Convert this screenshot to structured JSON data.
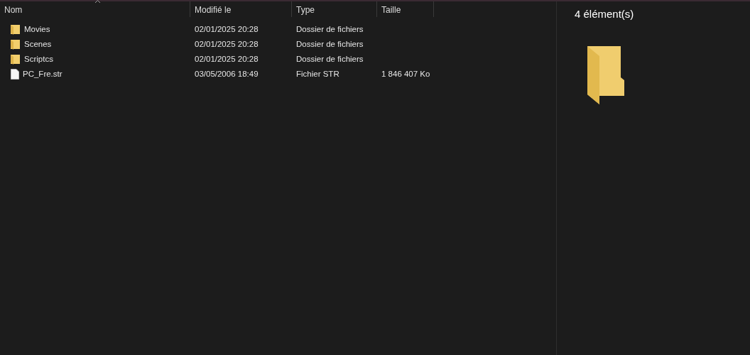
{
  "columns": [
    "Nom",
    "Modifié le",
    "Type",
    "Taille"
  ],
  "files": [
    {
      "kind": "folder",
      "name": "Movies",
      "modified": "02/01/2025 20:28",
      "type": "Dossier de fichiers"
    },
    {
      "kind": "folder",
      "name": "Scenes",
      "modified": "02/01/2025 20:28",
      "type": "Dossier de fichiers"
    },
    {
      "kind": "folder",
      "name": "Scriptcs",
      "modified": "02/01/2025 20:28",
      "type": "Dossier de fichiers"
    },
    {
      "kind": "file",
      "name": "PC_Fre.str",
      "modified": "03/05/2006 18:49",
      "type": "Fichier STR",
      "size": "1 846 407 Ko"
    }
  ],
  "details": {
    "count": "4 élément(s)"
  }
}
